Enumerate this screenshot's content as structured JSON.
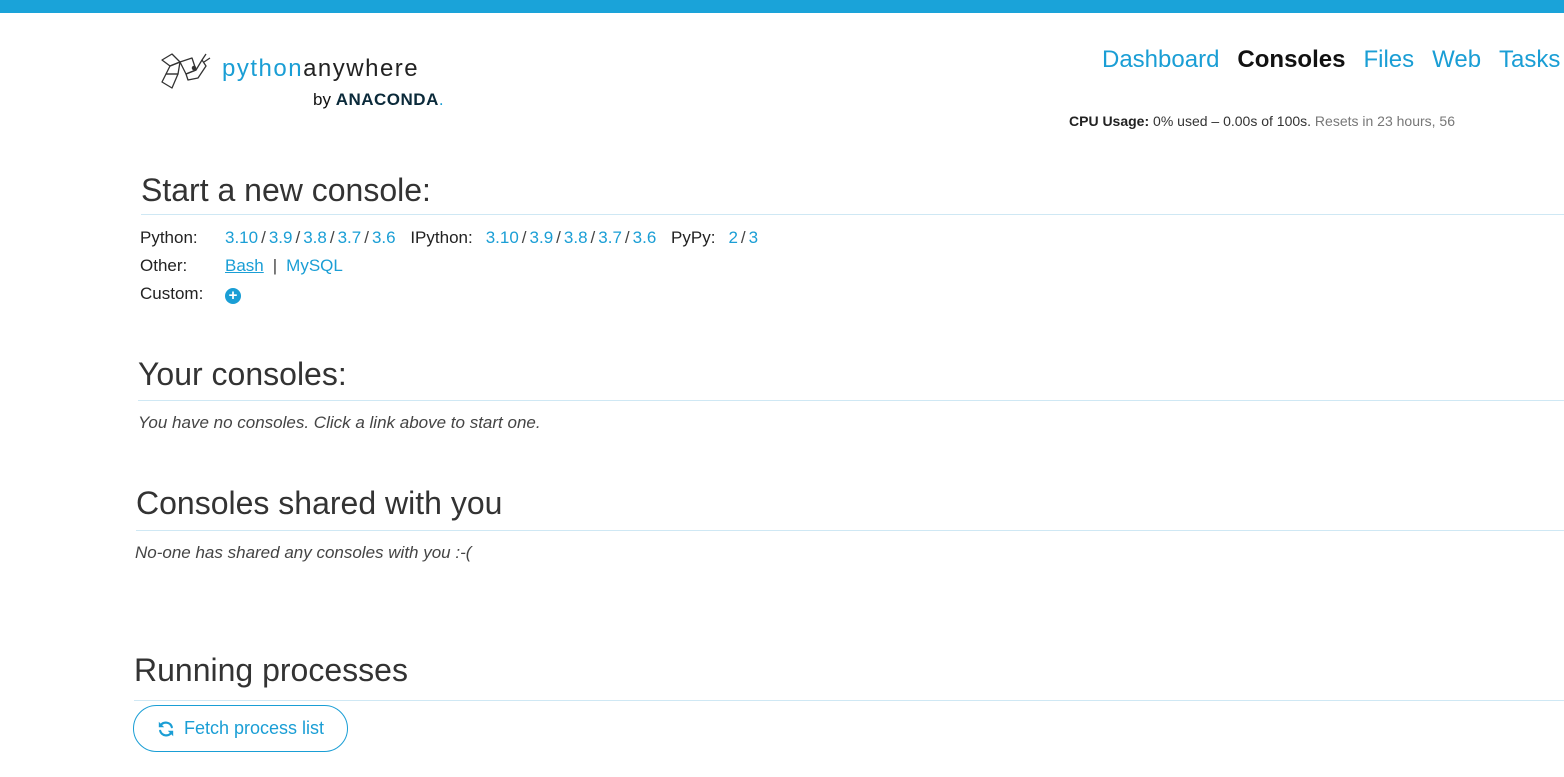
{
  "header": {
    "logo": {
      "python": "python",
      "anywhere": "anywhere",
      "by": "by",
      "anaconda": "ANACONDA",
      "dot": "."
    },
    "nav": [
      {
        "label": "Dashboard",
        "active": false
      },
      {
        "label": "Consoles",
        "active": true
      },
      {
        "label": "Files",
        "active": false
      },
      {
        "label": "Web",
        "active": false
      },
      {
        "label": "Tasks",
        "active": false
      }
    ],
    "cpu": {
      "label": "CPU Usage:",
      "usage": "0% used – 0.00s of 100s.",
      "resets": "Resets in 23 hours, 56"
    }
  },
  "start_console": {
    "title": "Start a new console:",
    "python_label": "Python:",
    "python_versions": [
      "3.10",
      "3.9",
      "3.8",
      "3.7",
      "3.6"
    ],
    "ipython_label": "IPython:",
    "ipython_versions": [
      "3.10",
      "3.9",
      "3.8",
      "3.7",
      "3.6"
    ],
    "pypy_label": "PyPy:",
    "pypy_versions": [
      "2",
      "3"
    ],
    "other_label": "Other:",
    "other_links": [
      "Bash",
      "MySQL"
    ],
    "custom_label": "Custom:"
  },
  "your_consoles": {
    "title": "Your consoles:",
    "empty": "You have no consoles. Click a link above to start one."
  },
  "shared_consoles": {
    "title": "Consoles shared with you",
    "empty": "No-one has shared any consoles with you :-("
  },
  "running_processes": {
    "title": "Running processes",
    "button_label": "Fetch process list"
  },
  "colors": {
    "accent": "#1a9ed5",
    "topbar": "#1aa3d9",
    "rule": "#cfe8f4"
  }
}
